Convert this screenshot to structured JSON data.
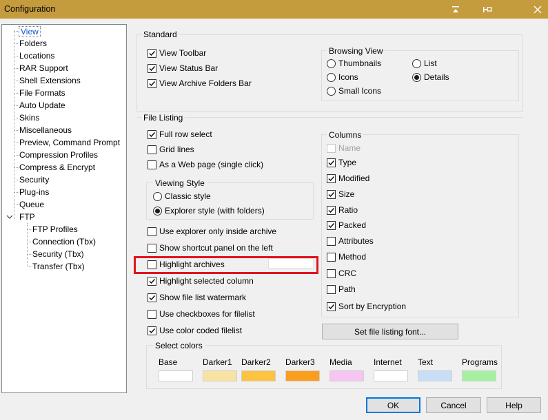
{
  "window": {
    "title": "Configuration"
  },
  "tree": {
    "items": [
      {
        "label": "View",
        "selected": true
      },
      {
        "label": "Folders"
      },
      {
        "label": "Locations"
      },
      {
        "label": "RAR Support"
      },
      {
        "label": "Shell Extensions"
      },
      {
        "label": "File Formats"
      },
      {
        "label": "Auto Update"
      },
      {
        "label": "Skins"
      },
      {
        "label": "Miscellaneous"
      },
      {
        "label": "Preview, Command Prompt"
      },
      {
        "label": "Compression Profiles"
      },
      {
        "label": "Compress & Encrypt"
      },
      {
        "label": "Security"
      },
      {
        "label": "Plug-ins"
      },
      {
        "label": "Queue"
      },
      {
        "label": "FTP",
        "expanded": true
      }
    ],
    "ftp_children": [
      {
        "label": "FTP Profiles"
      },
      {
        "label": "Connection (Tbx)"
      },
      {
        "label": "Security (Tbx)"
      },
      {
        "label": "Transfer (Tbx)"
      }
    ]
  },
  "standard": {
    "title": "Standard",
    "options": [
      {
        "label": "View Toolbar",
        "checked": true
      },
      {
        "label": "View Status Bar",
        "checked": true
      },
      {
        "label": "View Archive Folders Bar",
        "checked": true
      }
    ],
    "browsing_view": {
      "title": "Browsing View",
      "options": [
        {
          "label": "Thumbnails",
          "selected": false
        },
        {
          "label": "Icons",
          "selected": false
        },
        {
          "label": "Small Icons",
          "selected": false
        },
        {
          "label": "List",
          "selected": false
        },
        {
          "label": "Details",
          "selected": true
        }
      ]
    }
  },
  "file_listing": {
    "title": "File Listing",
    "options_top": [
      {
        "label": "Full row select",
        "checked": true
      },
      {
        "label": "Grid lines",
        "checked": false
      },
      {
        "label": "As a Web page (single click)",
        "checked": false
      }
    ],
    "viewing_style": {
      "title": "Viewing Style",
      "options": [
        {
          "label": "Classic style",
          "selected": false
        },
        {
          "label": "Explorer style (with folders)",
          "selected": true
        }
      ]
    },
    "options_bottom": [
      {
        "label": "Use explorer only inside archive",
        "checked": false
      },
      {
        "label": "Show shortcut panel on the left",
        "checked": false
      },
      {
        "label": "Highlight archives",
        "checked": false
      },
      {
        "label": "Highlight selected column",
        "checked": true
      },
      {
        "label": "Show file list watermark",
        "checked": true
      },
      {
        "label": "Use checkboxes for filelist",
        "checked": false
      },
      {
        "label": "Use color coded filelist",
        "checked": true
      }
    ],
    "columns": {
      "title": "Columns",
      "items": [
        {
          "label": "Name",
          "checked": false,
          "disabled": true
        },
        {
          "label": "Type",
          "checked": true
        },
        {
          "label": "Modified",
          "checked": true
        },
        {
          "label": "Size",
          "checked": true
        },
        {
          "label": "Ratio",
          "checked": true
        },
        {
          "label": "Packed",
          "checked": true
        },
        {
          "label": "Attributes",
          "checked": false
        },
        {
          "label": "Method",
          "checked": false
        },
        {
          "label": "CRC",
          "checked": false
        },
        {
          "label": "Path",
          "checked": false
        },
        {
          "label": "Sort by Encryption",
          "checked": true
        }
      ]
    },
    "font_button": "Set file listing font..."
  },
  "select_colors": {
    "title": "Select colors",
    "swatches": [
      {
        "label": "Base",
        "color": "#ffffff"
      },
      {
        "label": "Darker1",
        "color": "#f9e3a3"
      },
      {
        "label": "Darker2",
        "color": "#fcc240"
      },
      {
        "label": "Darker3",
        "color": "#fb9d1e"
      },
      {
        "label": "Media",
        "color": "#f7c5f2"
      },
      {
        "label": "Internet",
        "color": "#ffffff"
      },
      {
        "label": "Text",
        "color": "#c8def7"
      },
      {
        "label": "Programs",
        "color": "#a6f0a2"
      }
    ]
  },
  "buttons": {
    "ok": "OK",
    "cancel": "Cancel",
    "help": "Help"
  },
  "theme": {
    "titlebar": "#c49c3e",
    "highlight_frame": "#e0141e",
    "focus": "#0078d7"
  }
}
